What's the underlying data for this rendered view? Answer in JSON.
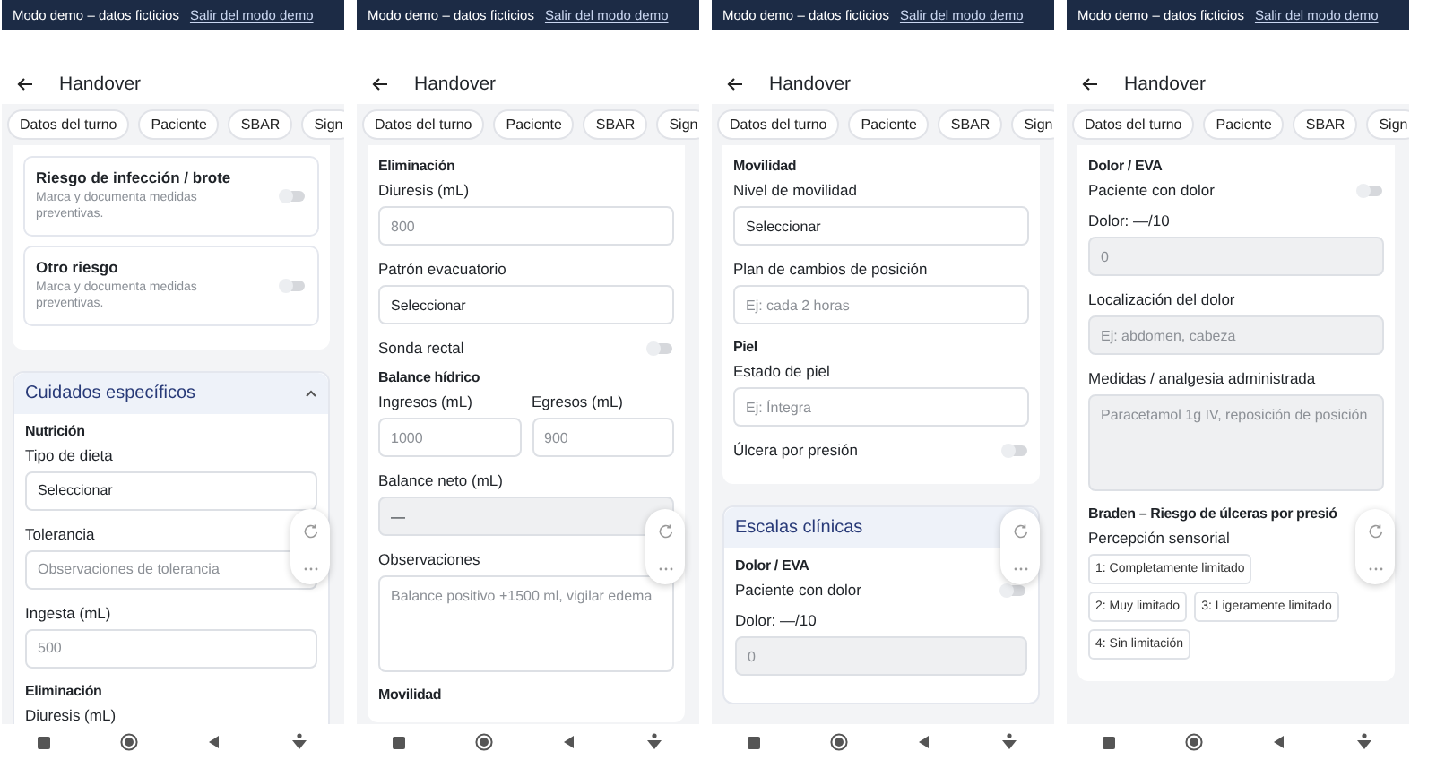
{
  "panels": [
    {
      "status_bar": {
        "mode": "Modo demo – datos ficticios",
        "link": "Salir del modo demo"
      },
      "title": "Handover",
      "tabs": [
        "Datos del turno",
        "Paciente",
        "SBAR",
        "Sign"
      ],
      "blocks": [
        {
          "kind": "card",
          "items": [
            {
              "kind": "risk",
              "title": "Riesgo de infección / brote",
              "description": "Marca y documenta medidas preventivas.",
              "on": false
            },
            {
              "kind": "risk",
              "title": "Otro riesgo",
              "description": "Marca y documenta medidas preventivas.",
              "on": false
            }
          ]
        },
        {
          "kind": "section",
          "title": "Cuidados específicos",
          "expanded": true,
          "items": [
            {
              "kind": "heading",
              "text": "Nutrición"
            },
            {
              "kind": "label",
              "text": "Tipo de dieta"
            },
            {
              "kind": "select",
              "value": "Seleccionar"
            },
            {
              "kind": "label",
              "text": "Tolerancia"
            },
            {
              "kind": "input",
              "placeholder": "Observaciones de tolerancia"
            },
            {
              "kind": "label",
              "text": "Ingesta (mL)"
            },
            {
              "kind": "input",
              "placeholder": "500"
            },
            {
              "kind": "heading",
              "text": "Eliminación"
            },
            {
              "kind": "label",
              "text": "Diuresis (mL)"
            }
          ]
        }
      ]
    },
    {
      "status_bar": {
        "mode": "Modo demo – datos ficticios",
        "link": "Salir del modo demo"
      },
      "title": "Handover",
      "tabs": [
        "Datos del turno",
        "Paciente",
        "SBAR",
        "Sign"
      ],
      "blocks": [
        {
          "kind": "card",
          "items": [
            {
              "kind": "heading",
              "text": "Eliminación"
            },
            {
              "kind": "label",
              "text": "Diuresis (mL)"
            },
            {
              "kind": "input",
              "placeholder": "800"
            },
            {
              "kind": "label",
              "text": "Patrón evacuatorio"
            },
            {
              "kind": "select",
              "value": "Seleccionar"
            },
            {
              "kind": "toggle",
              "label": "Sonda rectal",
              "on": false
            },
            {
              "kind": "heading",
              "text": "Balance hídrico"
            },
            {
              "kind": "pair",
              "fields": [
                {
                  "label": "Ingresos (mL)",
                  "placeholder": "1000"
                },
                {
                  "label": "Egresos (mL)",
                  "placeholder": "900"
                }
              ]
            },
            {
              "kind": "label",
              "text": "Balance neto (mL)"
            },
            {
              "kind": "input",
              "value": "—",
              "disabled": true
            },
            {
              "kind": "label",
              "text": "Observaciones"
            },
            {
              "kind": "textarea",
              "placeholder": "Balance positivo +1500 ml, vigilar edema"
            },
            {
              "kind": "heading",
              "text": "Movilidad"
            }
          ]
        }
      ]
    },
    {
      "status_bar": {
        "mode": "Modo demo – datos ficticios",
        "link": "Salir del modo demo"
      },
      "title": "Handover",
      "tabs": [
        "Datos del turno",
        "Paciente",
        "SBAR",
        "Sign"
      ],
      "blocks": [
        {
          "kind": "card",
          "items": [
            {
              "kind": "heading",
              "text": "Movilidad"
            },
            {
              "kind": "label",
              "text": "Nivel de movilidad"
            },
            {
              "kind": "select",
              "value": "Seleccionar"
            },
            {
              "kind": "label",
              "text": "Plan de cambios de posición"
            },
            {
              "kind": "input",
              "placeholder": "Ej: cada 2 horas"
            },
            {
              "kind": "heading",
              "text": "Piel"
            },
            {
              "kind": "label",
              "text": "Estado de piel"
            },
            {
              "kind": "input",
              "placeholder": "Ej: Íntegra"
            },
            {
              "kind": "toggle",
              "label": "Úlcera por presión",
              "on": false
            }
          ]
        },
        {
          "kind": "section",
          "title": "Escalas clínicas",
          "items": [
            {
              "kind": "heading",
              "text": "Dolor / EVA"
            },
            {
              "kind": "toggle",
              "label": "Paciente con dolor",
              "on": false
            },
            {
              "kind": "label",
              "text": "Dolor: —/10"
            },
            {
              "kind": "input",
              "placeholder": "0",
              "disabled": true
            }
          ]
        }
      ]
    },
    {
      "status_bar": {
        "mode": "Modo demo – datos ficticios",
        "link": "Salir del modo demo"
      },
      "title": "Handover",
      "tabs": [
        "Datos del turno",
        "Paciente",
        "SBAR",
        "Sign"
      ],
      "blocks": [
        {
          "kind": "card",
          "items": [
            {
              "kind": "heading",
              "text": "Dolor / EVA"
            },
            {
              "kind": "toggle",
              "label": "Paciente con dolor",
              "on": false
            },
            {
              "kind": "label",
              "text": "Dolor: —/10"
            },
            {
              "kind": "input",
              "placeholder": "0",
              "disabled": true
            },
            {
              "kind": "label",
              "text": "Localización del dolor"
            },
            {
              "kind": "input",
              "placeholder": "Ej: abdomen, cabeza",
              "disabled": true
            },
            {
              "kind": "label",
              "text": "Medidas / analgesia administrada"
            },
            {
              "kind": "textarea",
              "placeholder": "Paracetamol 1g IV, reposición de posición",
              "disabled": true
            },
            {
              "kind": "heading",
              "text": "Braden – Riesgo de úlceras por presió"
            },
            {
              "kind": "label",
              "text": "Percepción sensorial"
            },
            {
              "kind": "chips",
              "rows": [
                [
                  {
                    "label": "1: Completamente limitado",
                    "selected": false
                  }
                ],
                [
                  {
                    "label": "2: Muy limitado",
                    "selected": false
                  },
                  {
                    "label": "3: Ligeramente limitado",
                    "selected": false
                  }
                ],
                [
                  {
                    "label": "4: Sin limitación",
                    "selected": false
                  }
                ]
              ]
            }
          ]
        }
      ]
    }
  ]
}
